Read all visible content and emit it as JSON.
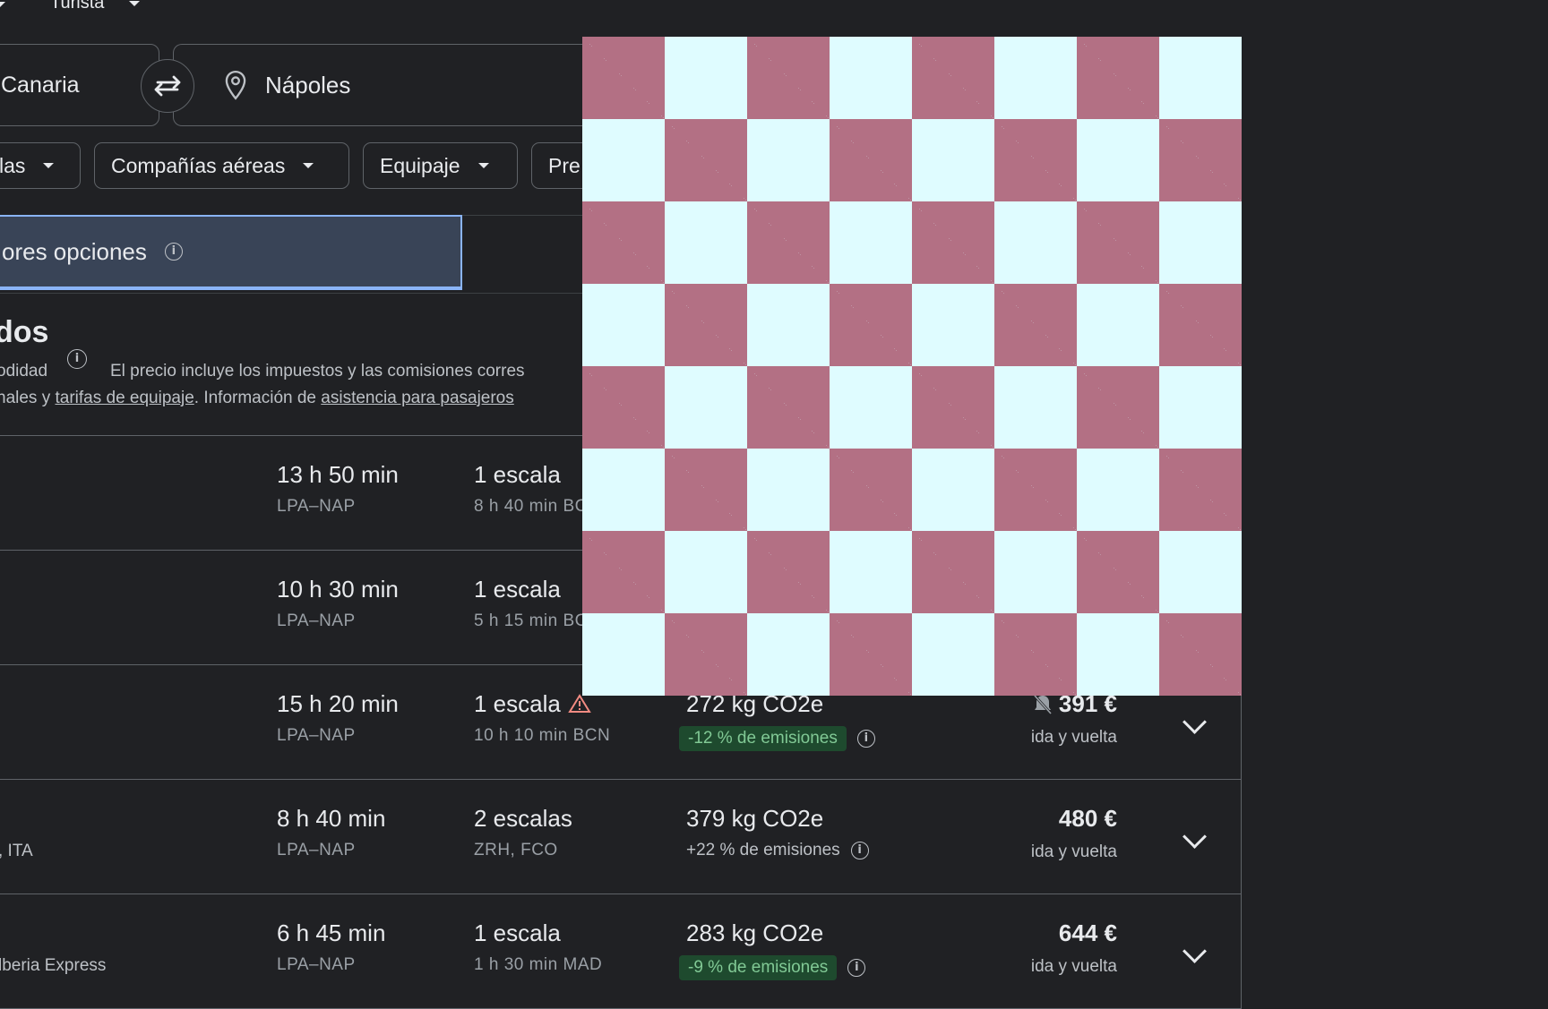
{
  "header": {
    "trip_class": "Turista"
  },
  "search": {
    "origin": "Canaria",
    "destination": "Nápoles"
  },
  "filters": [
    {
      "label": "las"
    },
    {
      "label": "Compañías aéreas"
    },
    {
      "label": "Equipaje"
    },
    {
      "label": "Pre"
    }
  ],
  "tabs": {
    "best": "ores opciones"
  },
  "results_header": {
    "title": "dos",
    "comfort_label": "odidad",
    "disclaimer_1": "El precio incluye los impuestos y las comisiones corres",
    "disclaimer_2_prefix": "nales y ",
    "baggage_link": "tarifas de equipaje",
    "disclaimer_2_mid": ". Información de ",
    "assistance_link": "asistencia para pasajeros"
  },
  "flights": [
    {
      "airline": "",
      "duration": "13 h 50 min",
      "route": "LPA–NAP",
      "stops": "1 escala",
      "stop_info": "8 h 40 min BC",
      "co2": "",
      "emissions": "",
      "price": "",
      "price_type": ""
    },
    {
      "airline": "",
      "duration": "10 h 30 min",
      "route": "LPA–NAP",
      "stops": "1 escala",
      "stop_info": "5 h 15 min BC",
      "co2": "",
      "emissions": "",
      "price": "",
      "price_type": ""
    },
    {
      "airline": "",
      "duration": "15 h 20 min",
      "route": "LPA–NAP",
      "stops": "1 escala",
      "stop_info": "10 h 10 min BCN",
      "co2": "272 kg CO2e",
      "emissions": "-12 % de emisiones",
      "price": "391 €",
      "price_type": "ida y vuelta"
    },
    {
      "airline": ", ITA",
      "duration": "8 h 40 min",
      "route": "LPA–NAP",
      "stops": "2 escalas",
      "stop_info": "ZRH, FCO",
      "co2": "379 kg CO2e",
      "emissions": "+22 % de emisiones",
      "price": "480 €",
      "price_type": "ida y vuelta"
    },
    {
      "airline": "lberia Express",
      "duration": "6 h 45 min",
      "route": "LPA–NAP",
      "stops": "1 escala",
      "stop_info": "1 h 30 min MAD",
      "co2": "283 kg CO2e",
      "emissions": "-9 % de emisiones",
      "price": "644 €",
      "price_type": "ida y vuelta"
    }
  ],
  "colors": {
    "background": "#202124",
    "accent": "#8ab4f8",
    "overlay_a": "#b37084",
    "overlay_b": "#dffcff",
    "green": "#81c995",
    "warning": "#f28b82"
  }
}
